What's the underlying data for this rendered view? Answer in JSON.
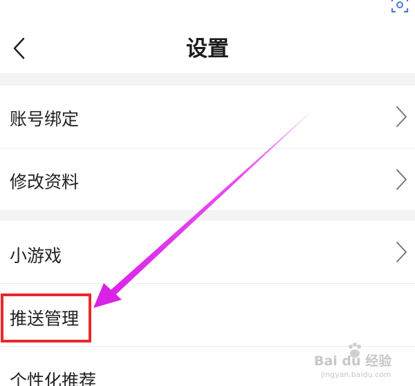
{
  "header": {
    "title": "设置",
    "back_icon": "chevron-left-icon",
    "scan_icon": "scan-icon"
  },
  "settings": {
    "items": [
      {
        "label": "账号绑定",
        "chevron": true
      },
      {
        "label": "修改资料",
        "chevron": true
      },
      {
        "label": "小游戏",
        "chevron": true
      },
      {
        "label": "推送管理",
        "chevron": false
      },
      {
        "label": "个性化推荐",
        "chevron": false
      }
    ]
  },
  "annotation": {
    "arrow_color": "#e030e8",
    "box_color": "#e8282b"
  },
  "watermark": {
    "brand": "Bai du 经验",
    "url": "jingyan.baidu.com"
  }
}
